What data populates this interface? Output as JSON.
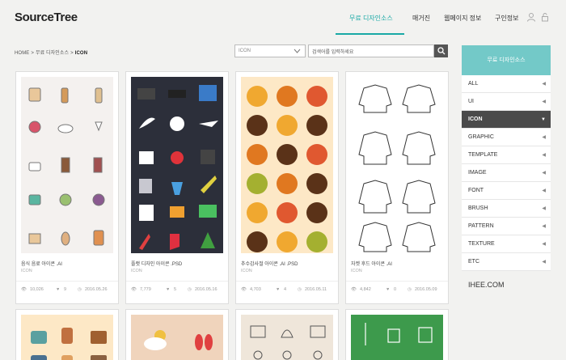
{
  "header": {
    "logo": "SourceTree",
    "nav": [
      "무료 디자인소스",
      "매거진",
      "웹페이지 정보",
      "구인정보"
    ]
  },
  "breadcrumb": [
    "HOME",
    "무료 디자인소스",
    "ICON"
  ],
  "filters": {
    "select_value": "ICON",
    "search_value": "검색어를 입력하세요"
  },
  "cards": [
    {
      "title": "음식 음료 아이콘 .AI",
      "category": "ICON",
      "views": "10,026",
      "likes": "9",
      "date": "2016.05.26"
    },
    {
      "title": "플랫 디자인 아이콘 .PSD",
      "category": "ICON",
      "views": "7,779",
      "likes": "5",
      "date": "2016.05.16"
    },
    {
      "title": "추수감사절 아이콘 .AI .PSD",
      "category": "ICON",
      "views": "4,703",
      "likes": "4",
      "date": "2016.05.11"
    },
    {
      "title": "자켓 후드 아이콘 .AI",
      "category": "ICON",
      "views": "4,842",
      "likes": "0",
      "date": "2016.05.09"
    }
  ],
  "sidebar": {
    "header": "무료 디자인소스",
    "items": [
      "ALL",
      "UI",
      "ICON",
      "GRAPHIC",
      "TEMPLATE",
      "IMAGE",
      "FONT",
      "BRUSH",
      "PATTERN",
      "TEXTURE",
      "ETC"
    ],
    "active": "ICON",
    "footer": "IHEE.COM"
  },
  "colors": {
    "accent": "#1aa9a6",
    "sidebar_header": "#73c9c8",
    "active_item": "#4a4a4a"
  }
}
